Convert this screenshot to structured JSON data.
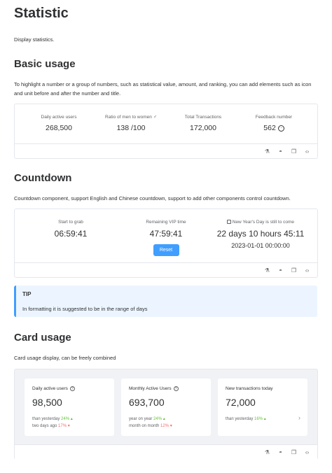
{
  "page": {
    "title": "Statistic",
    "description": "Display statistics."
  },
  "basic": {
    "heading": "Basic usage",
    "desc": "To highlight a number or a group of numbers, such as statistical value, amount, and ranking, you can add elements such as icon and unit before and after the number and title.",
    "stats": [
      {
        "title": "Daily active users",
        "value": "268,500"
      },
      {
        "title": "Ratio of men to women",
        "title_icon": "male-icon",
        "value": "138 /100"
      },
      {
        "title": "Total Transactions",
        "value": "172,000"
      },
      {
        "title": "Feedback number",
        "value": "562",
        "value_icon": "chat-icon"
      }
    ]
  },
  "countdown": {
    "heading": "Countdown",
    "desc": "Countdown component, support English and Chinese countdown, support to add other components control countdown.",
    "items": [
      {
        "title": "Start to grab",
        "value": "06:59:41"
      },
      {
        "title": "Remaining VIP time",
        "value": "47:59:41",
        "button": "Reset"
      },
      {
        "title": "New Year's Day is still to come",
        "title_icon": "calendar-icon",
        "value": "22 days 10 hours 45:11",
        "sub": "2023-01-01 00:00:00"
      }
    ]
  },
  "tip": {
    "title": "TIP",
    "content": "In formatting it is suggested to be in the range of days"
  },
  "card": {
    "heading": "Card usage",
    "desc": "Card usage display, can be freely combined",
    "cards": [
      {
        "title": "Daily active users",
        "value": "98,500",
        "lines": [
          {
            "label": "than yesterday",
            "pct": "24%",
            "trend": "up"
          },
          {
            "label": "two days ago",
            "pct": "17%",
            "trend": "down"
          }
        ]
      },
      {
        "title": "Monthly Active Users",
        "value": "693,700",
        "lines": [
          {
            "label": "year on year",
            "pct": "24%",
            "trend": "up"
          },
          {
            "label": "month on month",
            "pct": "12%",
            "trend": "down"
          }
        ]
      },
      {
        "title": "New transactions today",
        "value": "72,000",
        "lines": [
          {
            "label": "than yesterday",
            "pct": "16%",
            "trend": "up"
          }
        ]
      }
    ]
  },
  "colors": {
    "primary": "#409eff",
    "success": "#67c23a",
    "danger": "#f56c6c",
    "text": "#303133",
    "border": "#e4e7ed"
  }
}
